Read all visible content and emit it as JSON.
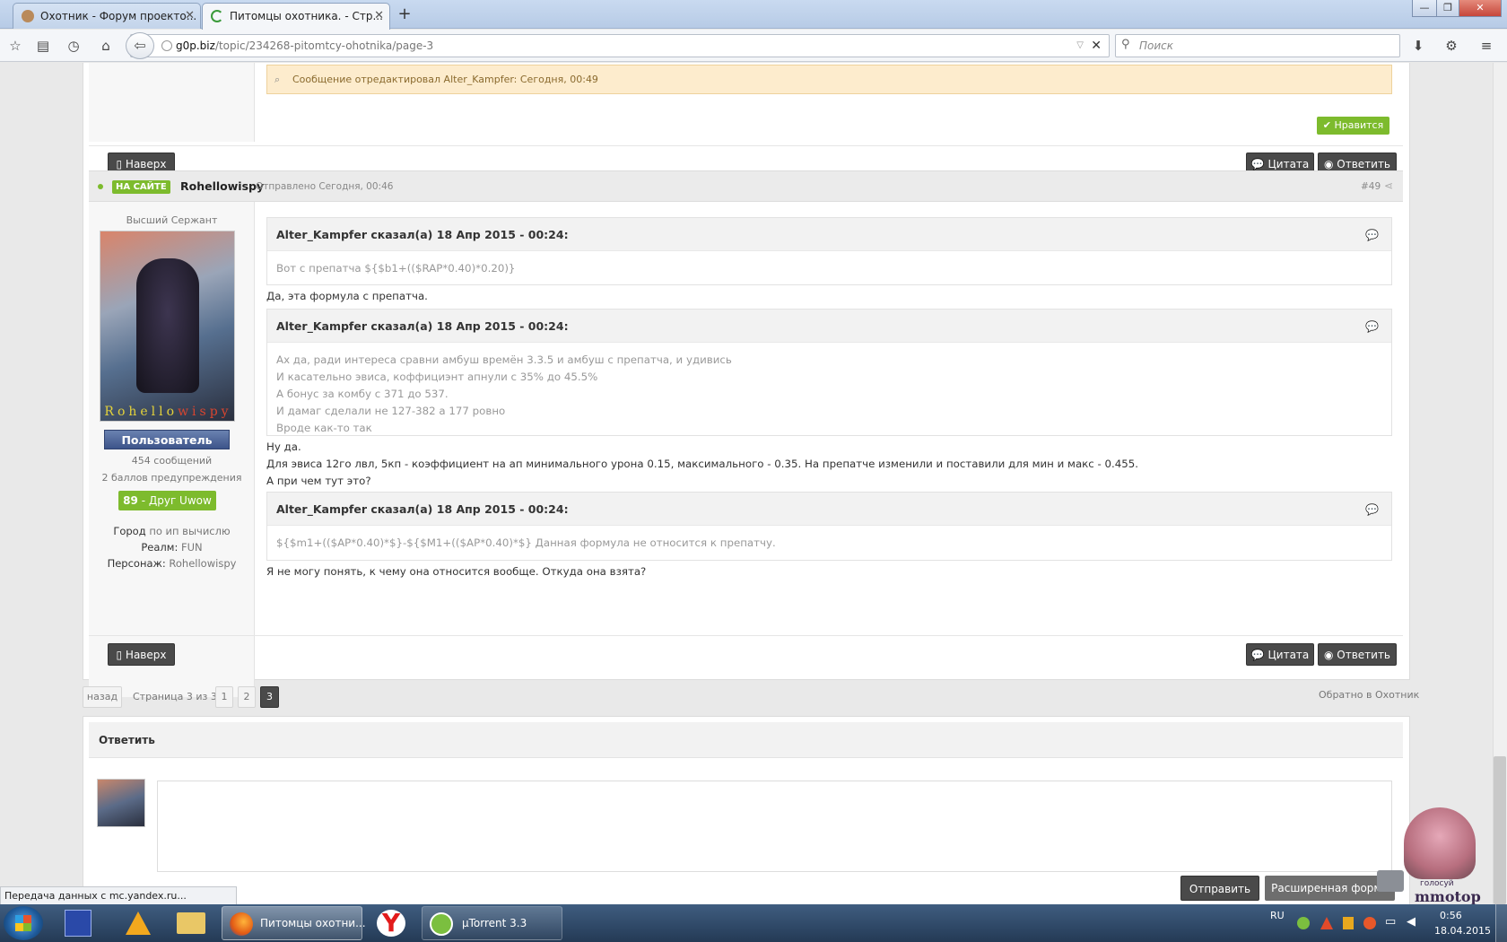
{
  "browser": {
    "tabs": [
      {
        "title": "Охотник - Форум проекто...",
        "active": false
      },
      {
        "title": "Питомцы охотника. - Стр...",
        "active": true
      }
    ],
    "new_tab": "+",
    "url_domain": "g0p.biz",
    "url_path": "/topic/234268-pitomtcy-ohotnika/page-3",
    "search_placeholder": "Поиск",
    "status_text": "Передача данных с mc.yandex.ru..."
  },
  "prev_post": {
    "edit_note": "Сообщение отредактировал Alter_Kampfer: Сегодня, 00:49",
    "like_label": "Нравится",
    "top_label": "Наверх",
    "quote_label": "Цитата",
    "reply_label": "Ответить"
  },
  "post": {
    "online_badge": "НА САЙТЕ",
    "author": "Rohellowispy",
    "posted": "Отправлено Сегодня, 00:46",
    "number": "#49",
    "rank": "Высший Сержант",
    "avatar_caption_a": "Rohello",
    "avatar_caption_b": "wispy",
    "group": "Пользователь",
    "posts_count": "454 сообщений",
    "warnings": "2 баллов предупреждения",
    "rep_value": "89",
    "rep_label": "- Друг Uwow",
    "city_label": "Город",
    "city_value": "по ип вычислю",
    "realm_label": "Реалм:",
    "realm_value": "FUN",
    "char_label": "Персонаж:",
    "char_value": "Rohellowispy",
    "quotes": [
      {
        "header": "Alter_Kampfer сказал(а) 18 Апр 2015 - 00:24:",
        "lines": [
          "Вот с препатча ${$b1+(($RAP*0.40)*0.20)}"
        ]
      },
      {
        "header": "Alter_Kampfer сказал(а) 18 Апр 2015 - 00:24:",
        "lines": [
          "Ах да, ради интереса сравни амбуш времён 3.3.5 и амбуш с препатча, и удивись",
          "И касательно эвиса, коффициэнт апнули с 35% до 45.5%",
          "А бонус за комбу с 371 до 537.",
          "И дамаг сделали не 127-382 а 177 ровно",
          "Вроде как-то так"
        ]
      },
      {
        "header": "Alter_Kampfer сказал(а) 18 Апр 2015 - 00:24:",
        "lines": [
          "${$m1+(($AP*0.40)*$}-${$M1+(($AP*0.40)*$} Данная формула не относится к препатчу."
        ]
      }
    ],
    "text_after_q1": "Да, эта формула с препатча.",
    "text_after_q2": [
      "Ну да.",
      "Для эвиса 12го лвл, 5кп - коэффициент на ап минимального урона 0.15, максимального - 0.35. На препатче изменили и поставили для мин и макс - 0.455.",
      "А при чем тут это?"
    ],
    "text_after_q3": "Я не могу понять, к чему она относится вообще. Откуда она взята?",
    "top_label": "Наверх",
    "quote_label": "Цитата",
    "reply_label": "Ответить"
  },
  "pagination": {
    "back": "назад",
    "info": "Страница 3 из 3",
    "pages": [
      "1",
      "2",
      "3"
    ],
    "current": "3",
    "back_to_forum": "Обратно в Охотник"
  },
  "reply": {
    "title": "Ответить",
    "send": "Отправить",
    "advanced": "Расширенная форма",
    "vote_text": "голосуй",
    "vote_logo": "mmotop"
  },
  "taskbar": {
    "firefox_label": "Питомцы охотни...",
    "utorrent_label": "µTorrent 3.3",
    "lang": "RU",
    "time": "0:56",
    "date": "18.04.2015"
  },
  "colors": {
    "online": "#7dbb2d",
    "like": "#7dbb2d",
    "edit_bg": "#fdeccd"
  }
}
